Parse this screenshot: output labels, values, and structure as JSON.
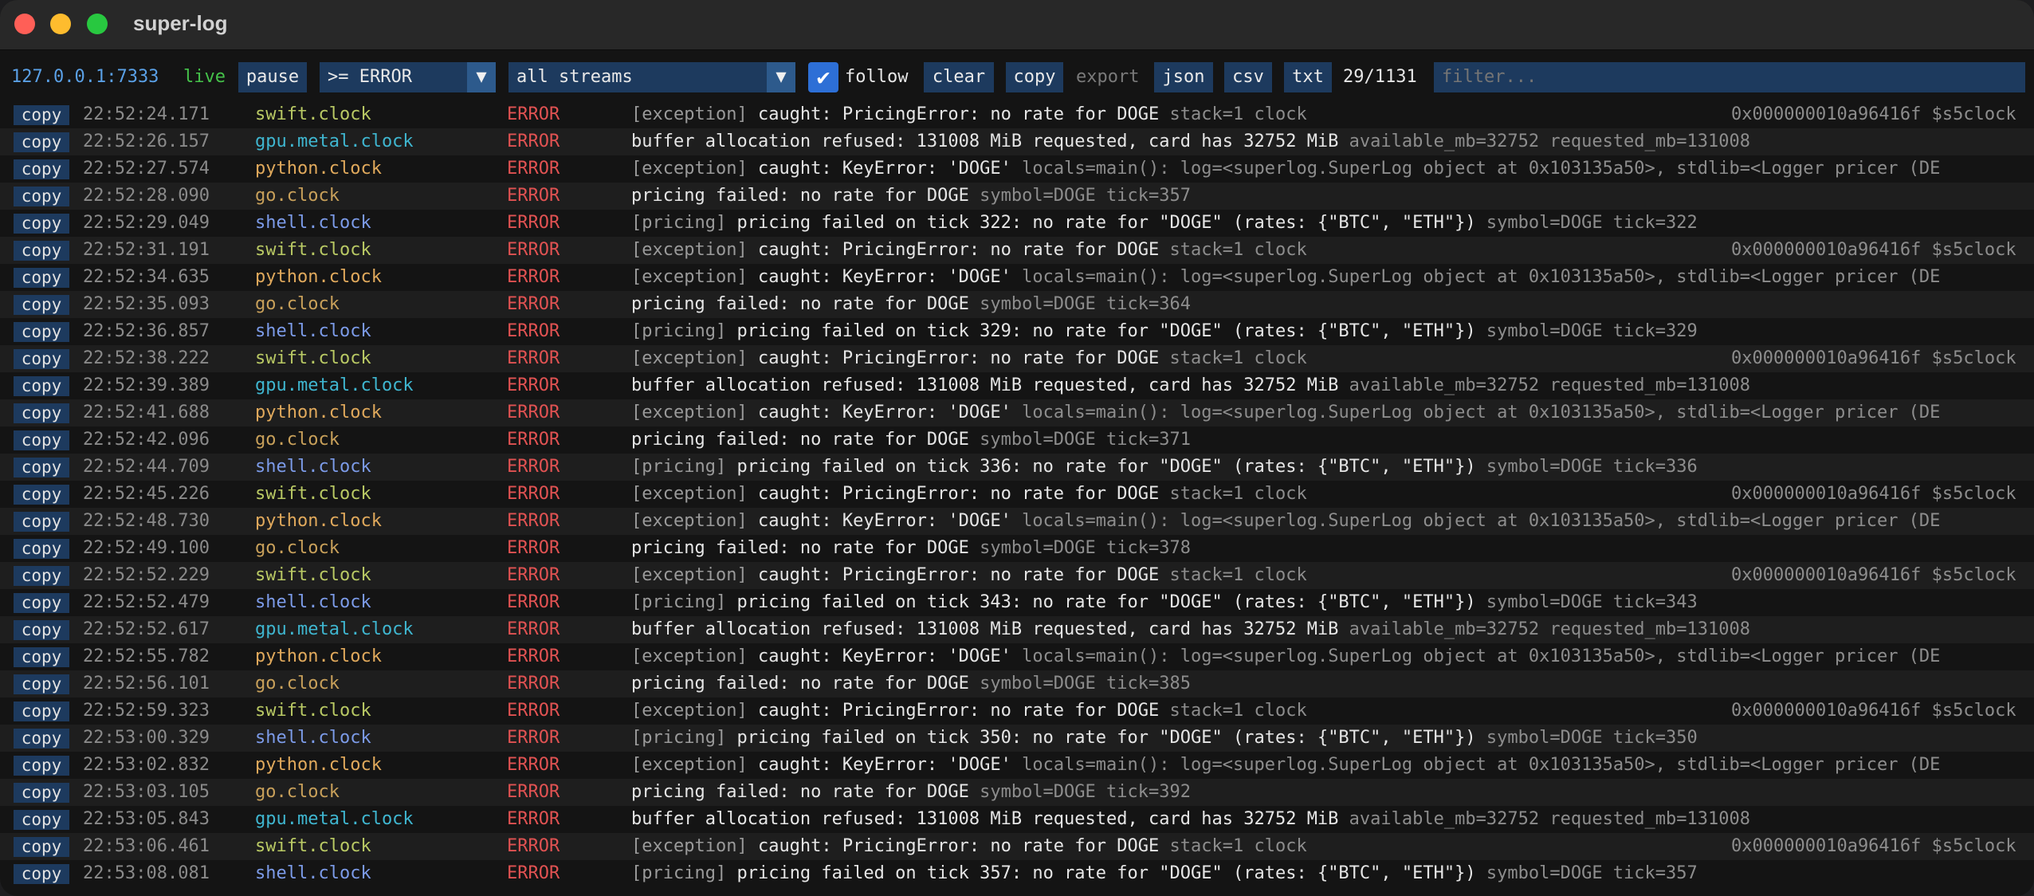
{
  "app": {
    "title": "super-log"
  },
  "toolbar": {
    "address": "127.0.0.1:7333",
    "status": "live",
    "pause_label": "pause",
    "level_select": ">= ERROR",
    "stream_select": "all streams",
    "follow_label": "follow",
    "follow_checked": true,
    "clear_label": "clear",
    "copy_label": "copy",
    "export_label": "export",
    "json_label": "json",
    "csv_label": "csv",
    "txt_label": "txt",
    "count": "29/1131",
    "filter_placeholder": "filter..."
  },
  "stream_colors": {
    "swift.clock": "#b9c964",
    "gpu.metal.clock": "#3fb6d0",
    "python.clock": "#e0a95c",
    "go.clock": "#c8a05a",
    "shell.clock": "#7c9be8"
  },
  "rows": [
    {
      "copy": "copy",
      "ts": "22:52:24.171",
      "stream": "swift.clock",
      "level": "ERROR",
      "tag": "[exception]",
      "msg": " caught: PricingError: no rate for DOGE",
      "meta": "  stack=1   clock",
      "addr": "0x000000010a96416f $s5clock"
    },
    {
      "copy": "copy",
      "ts": "22:52:26.157",
      "stream": "gpu.metal.clock",
      "level": "ERROR",
      "tag": "",
      "msg": "buffer allocation refused: 131008 MiB requested, card has 32752 MiB",
      "meta": "  available_mb=32752 requested_mb=131008",
      "addr": ""
    },
    {
      "copy": "copy",
      "ts": "22:52:27.574",
      "stream": "python.clock",
      "level": "ERROR",
      "tag": "[exception]",
      "msg": " caught: KeyError: 'DOGE'",
      "meta": "  locals=main(): log=<superlog.SuperLog object at 0x103135a50>, stdlib=<Logger pricer (DE",
      "addr": ""
    },
    {
      "copy": "copy",
      "ts": "22:52:28.090",
      "stream": "go.clock",
      "level": "ERROR",
      "tag": "",
      "msg": "pricing failed: no rate for DOGE",
      "meta": "  symbol=DOGE tick=357",
      "addr": ""
    },
    {
      "copy": "copy",
      "ts": "22:52:29.049",
      "stream": "shell.clock",
      "level": "ERROR",
      "tag": "[pricing]",
      "msg": " pricing failed on tick 322: no rate for \"DOGE\" (rates: {\"BTC\", \"ETH\"})",
      "meta": "  symbol=DOGE tick=322",
      "addr": ""
    },
    {
      "copy": "copy",
      "ts": "22:52:31.191",
      "stream": "swift.clock",
      "level": "ERROR",
      "tag": "[exception]",
      "msg": " caught: PricingError: no rate for DOGE",
      "meta": "  stack=1   clock",
      "addr": "0x000000010a96416f $s5clock"
    },
    {
      "copy": "copy",
      "ts": "22:52:34.635",
      "stream": "python.clock",
      "level": "ERROR",
      "tag": "[exception]",
      "msg": " caught: KeyError: 'DOGE'",
      "meta": "  locals=main(): log=<superlog.SuperLog object at 0x103135a50>, stdlib=<Logger pricer (DE",
      "addr": ""
    },
    {
      "copy": "copy",
      "ts": "22:52:35.093",
      "stream": "go.clock",
      "level": "ERROR",
      "tag": "",
      "msg": "pricing failed: no rate for DOGE",
      "meta": "  symbol=DOGE tick=364",
      "addr": ""
    },
    {
      "copy": "copy",
      "ts": "22:52:36.857",
      "stream": "shell.clock",
      "level": "ERROR",
      "tag": "[pricing]",
      "msg": " pricing failed on tick 329: no rate for \"DOGE\" (rates: {\"BTC\", \"ETH\"})",
      "meta": "  symbol=DOGE tick=329",
      "addr": ""
    },
    {
      "copy": "copy",
      "ts": "22:52:38.222",
      "stream": "swift.clock",
      "level": "ERROR",
      "tag": "[exception]",
      "msg": " caught: PricingError: no rate for DOGE",
      "meta": "  stack=1   clock",
      "addr": "0x000000010a96416f $s5clock"
    },
    {
      "copy": "copy",
      "ts": "22:52:39.389",
      "stream": "gpu.metal.clock",
      "level": "ERROR",
      "tag": "",
      "msg": "buffer allocation refused: 131008 MiB requested, card has 32752 MiB",
      "meta": "  available_mb=32752 requested_mb=131008",
      "addr": ""
    },
    {
      "copy": "copy",
      "ts": "22:52:41.688",
      "stream": "python.clock",
      "level": "ERROR",
      "tag": "[exception]",
      "msg": " caught: KeyError: 'DOGE'",
      "meta": "  locals=main(): log=<superlog.SuperLog object at 0x103135a50>, stdlib=<Logger pricer (DE",
      "addr": ""
    },
    {
      "copy": "copy",
      "ts": "22:52:42.096",
      "stream": "go.clock",
      "level": "ERROR",
      "tag": "",
      "msg": "pricing failed: no rate for DOGE",
      "meta": "  symbol=DOGE tick=371",
      "addr": ""
    },
    {
      "copy": "copy",
      "ts": "22:52:44.709",
      "stream": "shell.clock",
      "level": "ERROR",
      "tag": "[pricing]",
      "msg": " pricing failed on tick 336: no rate for \"DOGE\" (rates: {\"BTC\", \"ETH\"})",
      "meta": "  symbol=DOGE tick=336",
      "addr": ""
    },
    {
      "copy": "copy",
      "ts": "22:52:45.226",
      "stream": "swift.clock",
      "level": "ERROR",
      "tag": "[exception]",
      "msg": " caught: PricingError: no rate for DOGE",
      "meta": "  stack=1   clock",
      "addr": "0x000000010a96416f $s5clock"
    },
    {
      "copy": "copy",
      "ts": "22:52:48.730",
      "stream": "python.clock",
      "level": "ERROR",
      "tag": "[exception]",
      "msg": " caught: KeyError: 'DOGE'",
      "meta": "  locals=main(): log=<superlog.SuperLog object at 0x103135a50>, stdlib=<Logger pricer (DE",
      "addr": ""
    },
    {
      "copy": "copy",
      "ts": "22:52:49.100",
      "stream": "go.clock",
      "level": "ERROR",
      "tag": "",
      "msg": "pricing failed: no rate for DOGE",
      "meta": "  symbol=DOGE tick=378",
      "addr": ""
    },
    {
      "copy": "copy",
      "ts": "22:52:52.229",
      "stream": "swift.clock",
      "level": "ERROR",
      "tag": "[exception]",
      "msg": " caught: PricingError: no rate for DOGE",
      "meta": "  stack=1   clock",
      "addr": "0x000000010a96416f $s5clock"
    },
    {
      "copy": "copy",
      "ts": "22:52:52.479",
      "stream": "shell.clock",
      "level": "ERROR",
      "tag": "[pricing]",
      "msg": " pricing failed on tick 343: no rate for \"DOGE\" (rates: {\"BTC\", \"ETH\"})",
      "meta": "  symbol=DOGE tick=343",
      "addr": ""
    },
    {
      "copy": "copy",
      "ts": "22:52:52.617",
      "stream": "gpu.metal.clock",
      "level": "ERROR",
      "tag": "",
      "msg": "buffer allocation refused: 131008 MiB requested, card has 32752 MiB",
      "meta": "  available_mb=32752 requested_mb=131008",
      "addr": ""
    },
    {
      "copy": "copy",
      "ts": "22:52:55.782",
      "stream": "python.clock",
      "level": "ERROR",
      "tag": "[exception]",
      "msg": " caught: KeyError: 'DOGE'",
      "meta": "  locals=main(): log=<superlog.SuperLog object at 0x103135a50>, stdlib=<Logger pricer (DE",
      "addr": ""
    },
    {
      "copy": "copy",
      "ts": "22:52:56.101",
      "stream": "go.clock",
      "level": "ERROR",
      "tag": "",
      "msg": "pricing failed: no rate for DOGE",
      "meta": "  symbol=DOGE tick=385",
      "addr": ""
    },
    {
      "copy": "copy",
      "ts": "22:52:59.323",
      "stream": "swift.clock",
      "level": "ERROR",
      "tag": "[exception]",
      "msg": " caught: PricingError: no rate for DOGE",
      "meta": "  stack=1   clock",
      "addr": "0x000000010a96416f $s5clock"
    },
    {
      "copy": "copy",
      "ts": "22:53:00.329",
      "stream": "shell.clock",
      "level": "ERROR",
      "tag": "[pricing]",
      "msg": " pricing failed on tick 350: no rate for \"DOGE\" (rates: {\"BTC\", \"ETH\"})",
      "meta": "  symbol=DOGE tick=350",
      "addr": ""
    },
    {
      "copy": "copy",
      "ts": "22:53:02.832",
      "stream": "python.clock",
      "level": "ERROR",
      "tag": "[exception]",
      "msg": " caught: KeyError: 'DOGE'",
      "meta": "  locals=main(): log=<superlog.SuperLog object at 0x103135a50>, stdlib=<Logger pricer (DE",
      "addr": ""
    },
    {
      "copy": "copy",
      "ts": "22:53:03.105",
      "stream": "go.clock",
      "level": "ERROR",
      "tag": "",
      "msg": "pricing failed: no rate for DOGE",
      "meta": "  symbol=DOGE tick=392",
      "addr": ""
    },
    {
      "copy": "copy",
      "ts": "22:53:05.843",
      "stream": "gpu.metal.clock",
      "level": "ERROR",
      "tag": "",
      "msg": "buffer allocation refused: 131008 MiB requested, card has 32752 MiB",
      "meta": "  available_mb=32752 requested_mb=131008",
      "addr": ""
    },
    {
      "copy": "copy",
      "ts": "22:53:06.461",
      "stream": "swift.clock",
      "level": "ERROR",
      "tag": "[exception]",
      "msg": " caught: PricingError: no rate for DOGE",
      "meta": "  stack=1   clock",
      "addr": "0x000000010a96416f $s5clock"
    },
    {
      "copy": "copy",
      "ts": "22:53:08.081",
      "stream": "shell.clock",
      "level": "ERROR",
      "tag": "[pricing]",
      "msg": " pricing failed on tick 357: no rate for \"DOGE\" (rates: {\"BTC\", \"ETH\"})",
      "meta": "  symbol=DOGE tick=357",
      "addr": ""
    }
  ]
}
